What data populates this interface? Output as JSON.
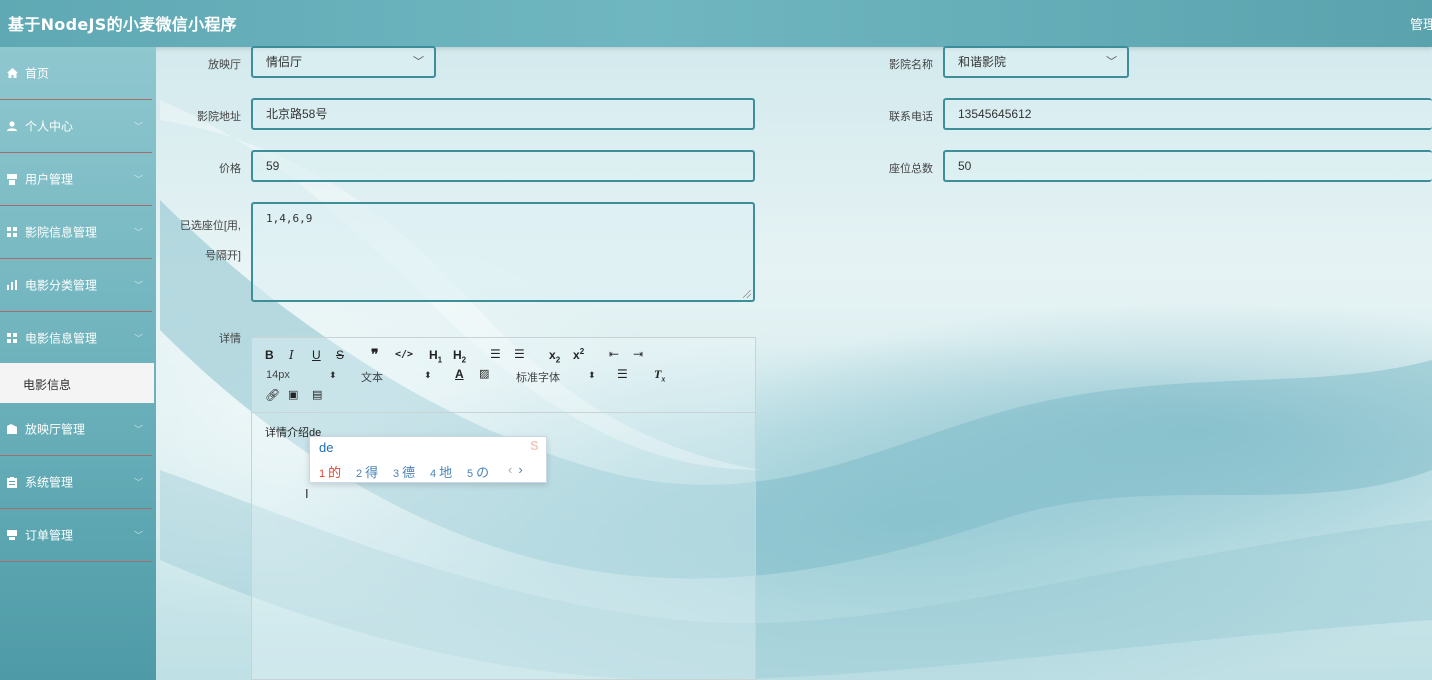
{
  "app": {
    "title": "基于NodeJS的小麦微信小程序",
    "header_right": "管理"
  },
  "sidebar": {
    "items": [
      {
        "label": "首页",
        "icon": "home-icon"
      },
      {
        "label": "个人中心",
        "icon": "user-icon"
      },
      {
        "label": "用户管理",
        "icon": "user-manage-icon"
      },
      {
        "label": "影院信息管理",
        "icon": "grid-icon"
      },
      {
        "label": "电影分类管理",
        "icon": "bar-chart-icon"
      },
      {
        "label": "电影信息管理",
        "icon": "grid-icon"
      },
      {
        "label": "放映厅管理",
        "icon": "hall-icon"
      },
      {
        "label": "系统管理",
        "icon": "settings-icon"
      },
      {
        "label": "订单管理",
        "icon": "order-icon"
      }
    ],
    "submenu_active": "电影信息"
  },
  "form": {
    "hall": {
      "label": "放映厅",
      "value": "情侣厅"
    },
    "cinema_name": {
      "label": "影院名称",
      "value": "和谐影院"
    },
    "cinema_address": {
      "label": "影院地址",
      "value": "北京路58号"
    },
    "phone": {
      "label": "联系电话",
      "value": "13545645612"
    },
    "price": {
      "label": "价格",
      "value": "59"
    },
    "seat_total": {
      "label": "座位总数",
      "value": "50"
    },
    "selected_seats": {
      "label_line1": "已选座位[用,",
      "label_line2": "号隔开]",
      "value": "1,4,6,9"
    },
    "details": {
      "label": "详情",
      "content": "详情介绍de"
    }
  },
  "editor": {
    "font_size": "14px",
    "paragraph": "文本",
    "font_family": "标准字体"
  },
  "ime": {
    "input": "de",
    "candidates": [
      {
        "num": "1",
        "text": "的"
      },
      {
        "num": "2",
        "text": "得"
      },
      {
        "num": "3",
        "text": "德"
      },
      {
        "num": "4",
        "text": "地"
      },
      {
        "num": "5",
        "text": "の"
      }
    ],
    "prev": "‹",
    "next": "›"
  },
  "colors": {
    "accent": "#3d8e98",
    "header": "#6fb6c0",
    "ime_selected": "#e0452c"
  }
}
